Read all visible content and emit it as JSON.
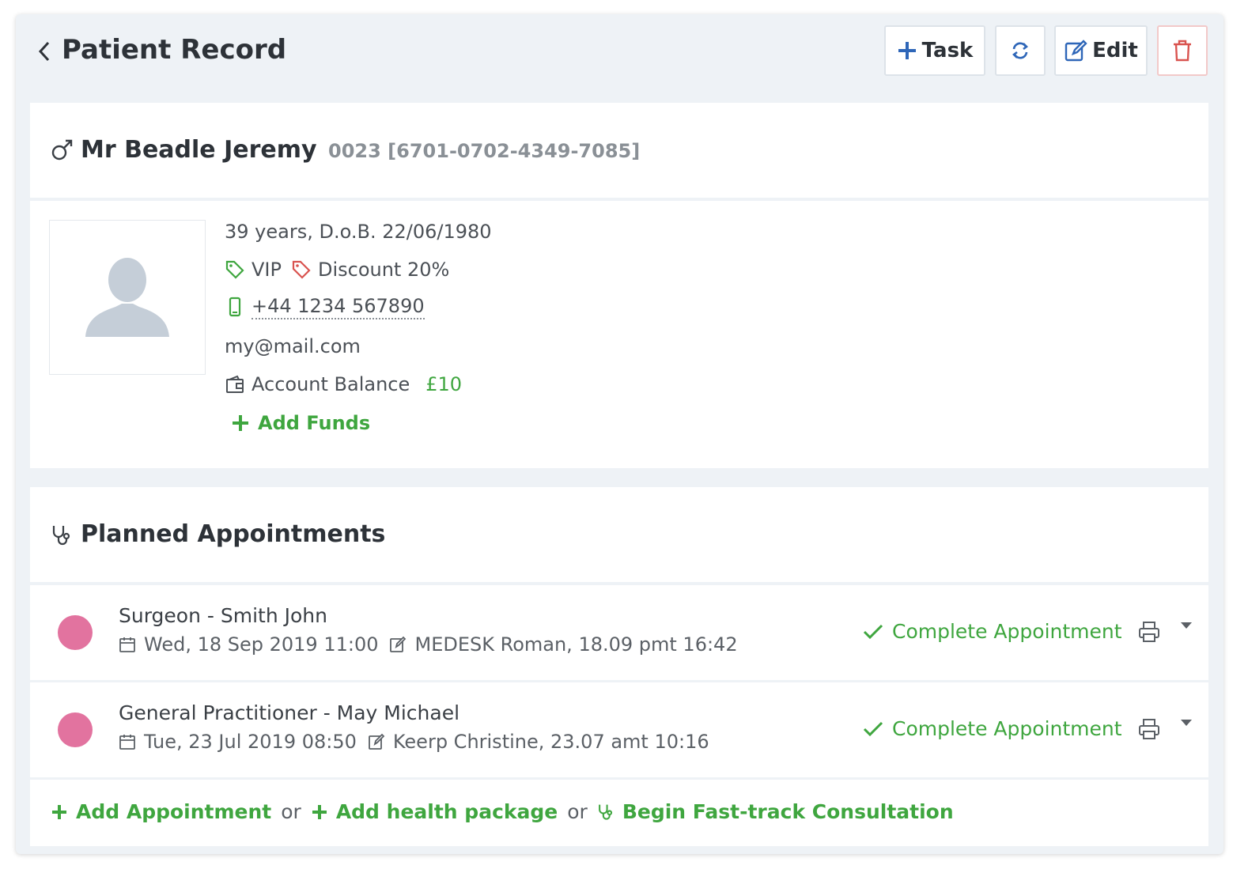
{
  "header": {
    "title": "Patient Record",
    "buttons": {
      "task_label": "Task",
      "edit_label": "Edit"
    }
  },
  "patient": {
    "name": "Mr Beadle Jeremy",
    "ids": "0023 [6701-0702-4349-7085]",
    "age_dob": "39 years, D.o.B. 22/06/1980",
    "tags": [
      {
        "label": "VIP",
        "color": "#3fa63f"
      },
      {
        "label": "Discount 20%",
        "color": "#d9534f"
      }
    ],
    "phone": "+44 1234 567890",
    "email": "my@mail.com",
    "balance_label": "Account Balance",
    "balance_amount": "£10",
    "add_funds_label": "Add Funds"
  },
  "appointments": {
    "title": "Planned Appointments",
    "complete_label": "Complete Appointment",
    "items": [
      {
        "title": "Surgeon - Smith John",
        "datetime": "Wed, 18 Sep 2019 11:00",
        "note": "MEDESK Roman, 18.09 pmt 16:42",
        "color": "#e2739f"
      },
      {
        "title": "General Practitioner - May Michael",
        "datetime": "Tue, 23 Jul 2019 08:50",
        "note": "Keerp Christine, 23.07 amt 10:16",
        "color": "#e2739f"
      }
    ],
    "footer": {
      "add_appointment": "Add Appointment",
      "or1": "or",
      "add_package": "Add health package",
      "or2": "or",
      "fast_track": "Begin Fast-track Consultation"
    }
  },
  "colors": {
    "accent_green": "#3fa63f",
    "danger_red": "#d9534f"
  }
}
